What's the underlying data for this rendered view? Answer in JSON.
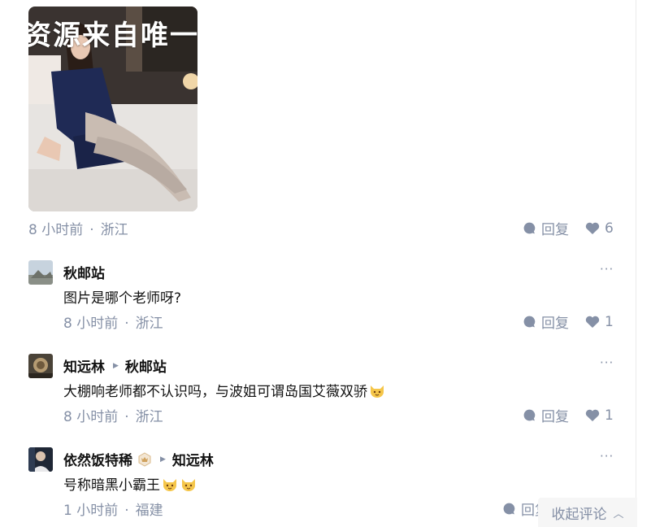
{
  "image": {
    "watermark": "资源来自唯一"
  },
  "post_meta": {
    "time": "8 小时前",
    "location": "浙江",
    "reply": "回复",
    "likes": "6"
  },
  "comments": [
    {
      "author": "秋邮站",
      "text": "图片是哪个老师呀?",
      "time": "8 小时前",
      "location": "浙江",
      "reply": "回复",
      "likes": "1"
    },
    {
      "author": "知远林",
      "reply_to": "秋邮站",
      "text": "大棚响老师都不认识吗，与波姐可谓岛国艾薇双骄",
      "time": "8 小时前",
      "location": "浙江",
      "reply": "回复",
      "likes": "1"
    },
    {
      "author": "依然饭特稀",
      "reply_to": "知远林",
      "text": "号称暗黑小霸王",
      "time": "1 小时前",
      "location": "福建",
      "reply": "回复"
    }
  ],
  "ui": {
    "more": "···",
    "dot": "·",
    "collapse": "收起评论"
  },
  "colors": {
    "meta_gray": "#8590a6",
    "text": "#121212",
    "emoji_yellow": "#f5c64a"
  }
}
